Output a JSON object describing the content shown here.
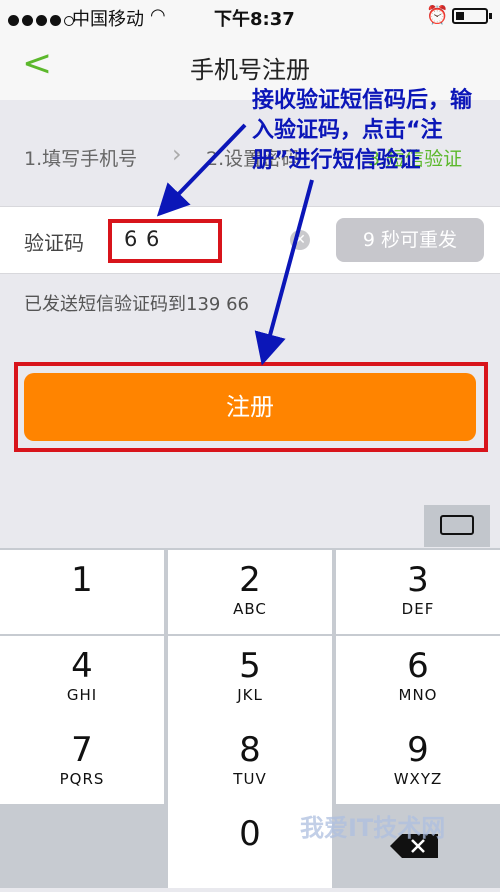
{
  "status": {
    "carrier": "中国移动",
    "time": "下午8:37"
  },
  "nav": {
    "title": "手机号注册"
  },
  "steps": [
    {
      "label": "1.填写手机号"
    },
    {
      "label": "2.设置密码"
    },
    {
      "label": "3.短信验证"
    }
  ],
  "form": {
    "code_label": "验证码",
    "code_value": "6   6",
    "resend_label": "9 秒可重发",
    "sent_info": "已发送短信验证码到139       66"
  },
  "register": {
    "label": "注册"
  },
  "annotation": {
    "text": "接收验证短信码后，输入验证码，点击“注册”进行短信验证"
  },
  "keyboard": {
    "keys": [
      {
        "num": "1",
        "letters": ""
      },
      {
        "num": "2",
        "letters": "ABC"
      },
      {
        "num": "3",
        "letters": "DEF"
      },
      {
        "num": "4",
        "letters": "GHI"
      },
      {
        "num": "5",
        "letters": "JKL"
      },
      {
        "num": "6",
        "letters": "MNO"
      },
      {
        "num": "7",
        "letters": "PQRS"
      },
      {
        "num": "8",
        "letters": "TUV"
      },
      {
        "num": "9",
        "letters": "WXYZ"
      },
      {
        "num": "0",
        "letters": ""
      }
    ]
  },
  "watermark": "我爱IT技术网",
  "colors": {
    "accent_green": "#5cb82c",
    "button_orange": "#ff8400",
    "highlight_red": "#d8141b",
    "annotation_blue": "#0b16b8"
  }
}
